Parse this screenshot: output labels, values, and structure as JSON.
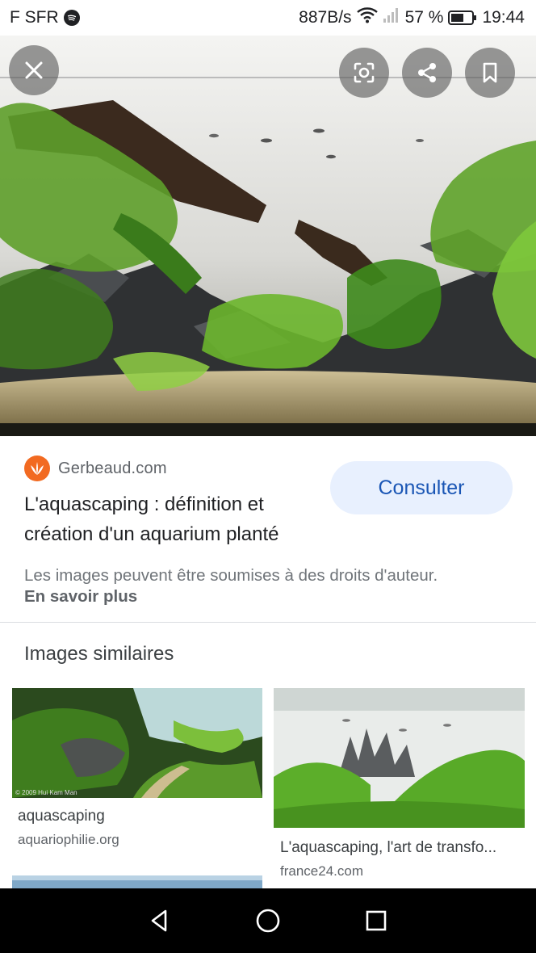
{
  "status_bar": {
    "carrier": "F SFR",
    "net_speed": "887B/s",
    "battery": "57 %",
    "time": "19:44"
  },
  "hero": {
    "icons": [
      "close-icon",
      "lens-icon",
      "share-icon",
      "bookmark-icon"
    ]
  },
  "result": {
    "source": "Gerbeaud.com",
    "title": "L'aquascaping : définition et création d'un aquarium planté",
    "action_label": "Consulter",
    "copyright_notice": "Les images peuvent être soumises à des droits d'auteur.",
    "learn_more": "En savoir plus"
  },
  "similar": {
    "heading": "Images similaires",
    "items": [
      {
        "label": "aquascaping",
        "domain": "aquariophilie.org",
        "watermark": "© 2009 Hui Kam Man"
      },
      {
        "label": "L'aquascaping, l'art de transfo...",
        "domain": "france24.com"
      }
    ]
  },
  "colors": {
    "accent_button_bg": "#e8f0fe",
    "accent_button_text": "#1a56b5",
    "source_logo": "#f26a21"
  },
  "nav": {
    "icons": [
      "back-icon",
      "home-icon",
      "recents-icon"
    ]
  }
}
